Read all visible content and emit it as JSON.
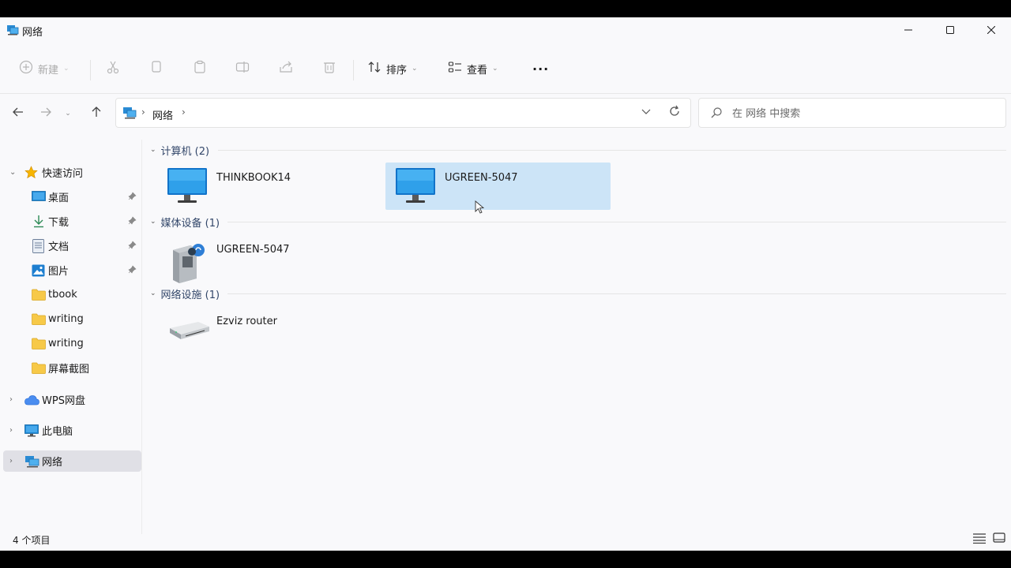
{
  "window": {
    "title": "网络",
    "controls": [
      "minimize",
      "maximize",
      "close"
    ]
  },
  "toolbar": {
    "new_label": "新建",
    "sort_label": "排序",
    "view_label": "查看",
    "more_label": "···",
    "icons": [
      "cut-icon",
      "copy-icon",
      "paste-icon",
      "rename-icon",
      "share-icon",
      "delete-icon"
    ]
  },
  "address": {
    "segments": [
      "网络"
    ]
  },
  "search": {
    "placeholder": "在 网络 中搜索"
  },
  "sidebar": {
    "quick_access_label": "快速访问",
    "items": [
      {
        "label": "桌面",
        "pinned": true,
        "icon": "desktop-icon"
      },
      {
        "label": "下载",
        "pinned": true,
        "icon": "download-icon"
      },
      {
        "label": "文档",
        "pinned": true,
        "icon": "document-icon"
      },
      {
        "label": "图片",
        "pinned": true,
        "icon": "pictures-icon"
      },
      {
        "label": "tbook",
        "pinned": false,
        "icon": "folder-icon"
      },
      {
        "label": "writing",
        "pinned": false,
        "icon": "folder-icon"
      },
      {
        "label": "writing",
        "pinned": false,
        "icon": "folder-icon"
      },
      {
        "label": "屏幕截图",
        "pinned": false,
        "icon": "folder-icon"
      }
    ],
    "wps_label": "WPS网盘",
    "thispc_label": "此电脑",
    "network_label": "网络"
  },
  "groups": [
    {
      "title": "计算机 (2)",
      "items": [
        {
          "name": "THINKBOOK14",
          "icon": "monitor-icon",
          "selected": false
        },
        {
          "name": "UGREEN-5047",
          "icon": "monitor-icon",
          "selected": true
        }
      ]
    },
    {
      "title": "媒体设备 (1)",
      "items": [
        {
          "name": "UGREEN-5047",
          "icon": "media-device-icon",
          "selected": false
        }
      ]
    },
    {
      "title": "网络设施 (1)",
      "items": [
        {
          "name": "Ezviz router",
          "icon": "router-icon",
          "selected": false
        }
      ]
    }
  ],
  "status": {
    "count": "4 个项目"
  },
  "colors": {
    "selection": "#cce4f7",
    "group_header": "#33476a",
    "window_bg": "#f9f9fb"
  }
}
